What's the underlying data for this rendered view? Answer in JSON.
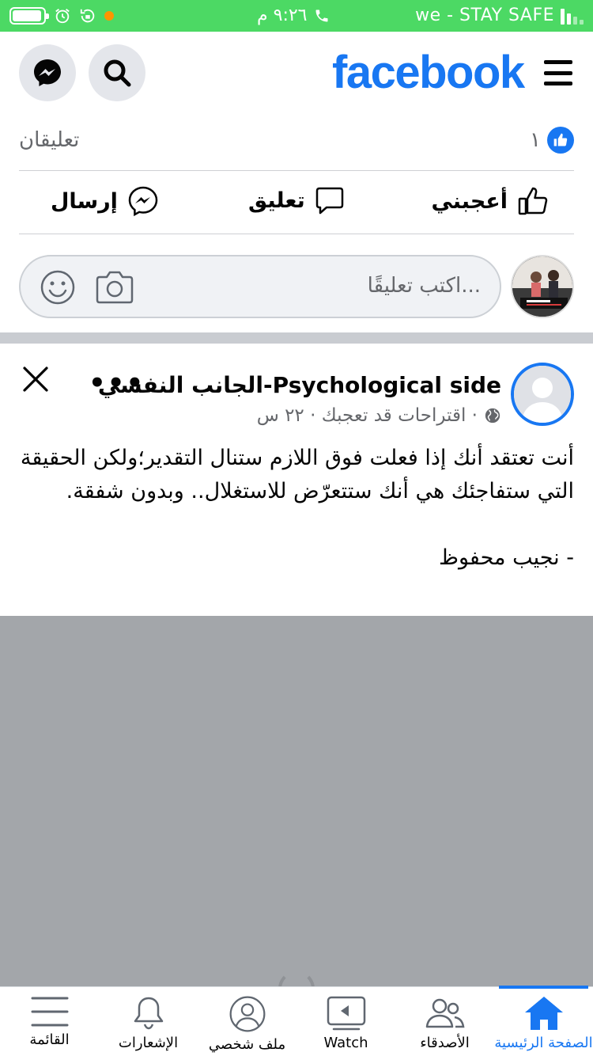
{
  "status_bar": {
    "time": "٩:٢٦ م",
    "carrier": "we - STAY SAFE",
    "battery_level": 0.95,
    "colors": {
      "background": "#4cd964",
      "orange_dot": "#ff9500"
    }
  },
  "header": {
    "logo": "facebook",
    "brand_color": "#1877f2"
  },
  "reactions": {
    "like_count": "١",
    "comments_count": "تعليقان"
  },
  "actions": {
    "like_label": "أعجبني",
    "comment_label": "تعليق",
    "send_label": "إرسال"
  },
  "composer": {
    "placeholder": "اكتب تعليقًا..."
  },
  "post": {
    "author": "الجانب النفسي-Psychological side",
    "meta": "اقتراحات قد تعجبك · ٢٢ س ·",
    "more": "•••",
    "text": "أنت تعتقد أنك إذا فعلت فوق اللازم ستنال التقدير؛ولكن الحقيقة التي ستفاجئك هي أنك ستتعرّض للاستغلال.. وبدون شفقة.\n\n- نجيب محفوظ"
  },
  "bottom_nav": {
    "items": [
      {
        "label": "القائمة",
        "icon": "menu-icon"
      },
      {
        "label": "الإشعارات",
        "icon": "bell-icon"
      },
      {
        "label": "ملف شخصي",
        "icon": "profile-icon"
      },
      {
        "label": "Watch",
        "icon": "watch-icon"
      },
      {
        "label": "الأصدقاء",
        "icon": "friends-icon"
      },
      {
        "label": "الصفحة الرئيسية",
        "icon": "home-icon",
        "active": true
      }
    ]
  }
}
